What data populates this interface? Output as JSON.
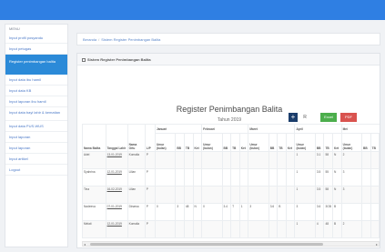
{
  "sidebar": {
    "header": "MENU",
    "items": [
      {
        "label": "Input profil posyandu"
      },
      {
        "label": "Input petugas"
      },
      {
        "label": "Register penimbangan balita",
        "active": true
      },
      {
        "label": "Input data ibu hamil"
      },
      {
        "label": "Input data KB"
      },
      {
        "label": "Input laporan ibu hamil"
      },
      {
        "label": "Input data bayi lahir & kematian"
      },
      {
        "label": "Input data PUS-WUS"
      },
      {
        "label": "Input laporan"
      },
      {
        "label": "Input laporan"
      },
      {
        "label": "Input artikel"
      },
      {
        "label": "Logout"
      }
    ]
  },
  "breadcrumb": {
    "home": "Beranda",
    "current": "Sistem Register Penimbangan Balita"
  },
  "panel": {
    "heading": "Sistem Register Penimbangan Balita"
  },
  "report": {
    "title": "Register Penimbangan Balita",
    "subtitle": "Tahun 2019"
  },
  "buttons": {
    "add": "+",
    "reset": "R",
    "excel": "Excel",
    "pdf": "PDF"
  },
  "table": {
    "fixed_headers": [
      "Nama Balita",
      "Tanggal Lahir",
      "Nama Ortu",
      "L/P"
    ],
    "months": [
      "Januari",
      "Februari",
      "Maret",
      "April",
      "Mei"
    ],
    "sub_headers": [
      "Umur (bulan)",
      "BB",
      "TB",
      "Ket"
    ],
    "rows": [
      {
        "name": "Adel",
        "dob": "13-01-2019",
        "parent": "Komalia",
        "lp": "P",
        "cells": [
          "",
          "",
          "",
          "",
          "",
          "",
          "",
          "",
          "",
          "",
          "",
          "",
          "1",
          "3.1",
          "58",
          "N",
          "2",
          "",
          "",
          ""
        ]
      },
      {
        "name": "Syahrina",
        "dob": "12-01-2019",
        "parent": "Lilian",
        "lp": "P",
        "cells": [
          "",
          "",
          "",
          "",
          "",
          "",
          "",
          "",
          "",
          "",
          "",
          "",
          "1",
          "3.5",
          "55",
          "N",
          "3",
          "",
          "",
          ""
        ]
      },
      {
        "name": "Tina",
        "dob": "16-02-2019",
        "parent": "Lilian",
        "lp": "P",
        "cells": [
          "",
          "",
          "",
          "",
          "",
          "",
          "",
          "",
          "",
          "",
          "",
          "",
          "1",
          "3.5",
          "58",
          "N",
          "3",
          "",
          "",
          ""
        ]
      },
      {
        "name": "Nadeeva",
        "dob": "07-01-2019",
        "parent": "Dinarsa",
        "lp": "P",
        "cells": [
          "0",
          "3",
          "48",
          "N",
          "0",
          "3.4",
          "T",
          "1",
          "3",
          "3.6",
          "B",
          "",
          "3",
          "3.6",
          "3GB",
          "B",
          "",
          "",
          "",
          ""
        ]
      },
      {
        "name": "Melati",
        "dob": "12-01-2019",
        "parent": "Komalia",
        "lp": "P",
        "cells": [
          "",
          "",
          "",
          "",
          "",
          "",
          "",
          "",
          "",
          "",
          "",
          "",
          "1",
          "4",
          "48",
          "B",
          "2",
          "",
          "",
          ""
        ]
      }
    ]
  }
}
